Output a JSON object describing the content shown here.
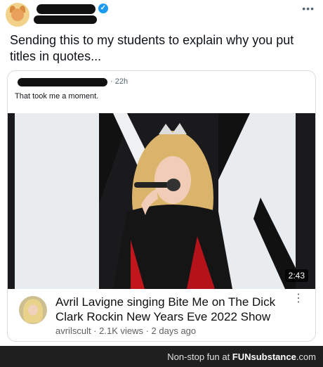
{
  "tweet": {
    "text": "Sending this to my students to explain why you put titles in quotes...",
    "verified_icon": "verified-badge-icon",
    "more_icon": "more-horizontal-icon"
  },
  "quote": {
    "time": "· 22h",
    "text": "That took me a moment."
  },
  "video": {
    "duration": "2:43",
    "title": "Avril Lavigne singing Bite Me on The Dick Clark Rockin New Years Eve 2022 Show",
    "channel": "avrilscult",
    "views": "2.1K views",
    "age": "2 days ago",
    "sub_line": "avrilscult · 2.1K views · 2 days ago"
  },
  "footer": {
    "text": "Non-stop fun at ",
    "brand": "FUNsubstance",
    "suffix": ".com"
  },
  "colors": {
    "verified": "#1d9bf0",
    "footer_bg": "#1f1f1f"
  }
}
